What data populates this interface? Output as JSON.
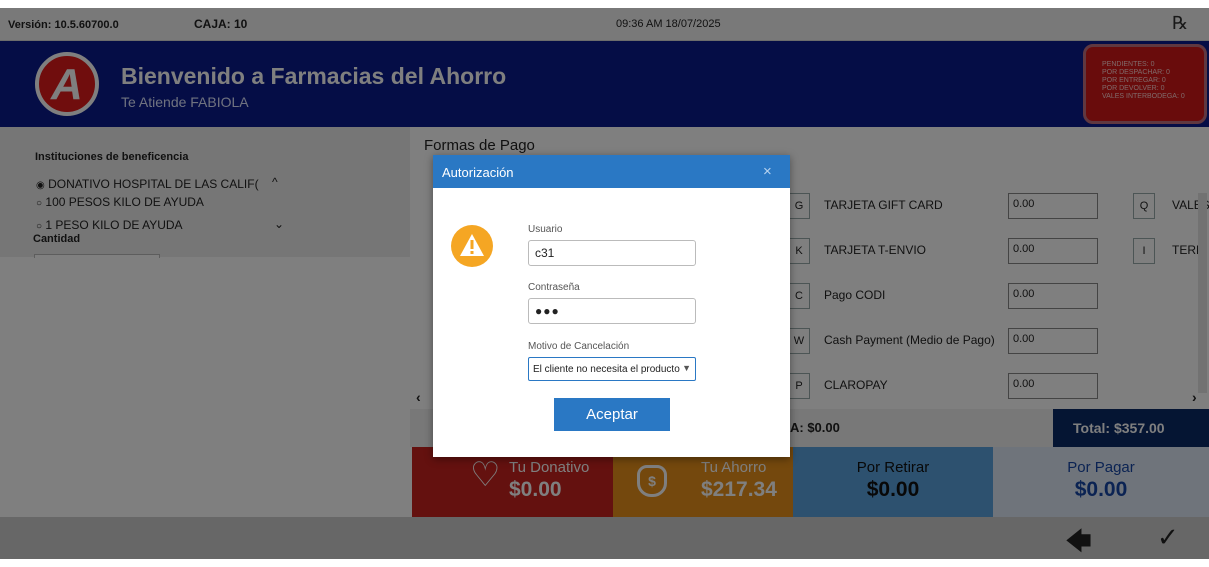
{
  "topbar": {
    "version": "Versión: 10.5.60700.0",
    "register": "CAJA: 10",
    "datetime": "09:36 AM 18/07/2025",
    "rx_icon": "prescription-icon"
  },
  "header": {
    "logo_letter": "A",
    "title": "Bienvenido a Farmacias del Ahorro",
    "subtitle": "Te Atiende FABIOLA",
    "status_lines": [
      "PENDIENTES: 0",
      "POR DESPACHAR: 0",
      "POR ENTREGAR: 0",
      "POR DEVOLVER: 0",
      "VALES INTERBODEGA: 0"
    ]
  },
  "charity": {
    "heading": "Instituciones de beneficencia",
    "options": [
      {
        "label": "DONATIVO HOSPITAL DE LAS CALIF(",
        "selected": true
      },
      {
        "label": "100 PESOS KILO DE AYUDA",
        "selected": false
      },
      {
        "label": "1 PESO KILO DE AYUDA",
        "selected": false
      }
    ],
    "quantity_label": "Cantidad",
    "quantity_value": ""
  },
  "payment": {
    "title": "Formas de Pago",
    "rows": [
      {
        "key": "G",
        "label": "TARJETA GIFT CARD",
        "value": "0.00",
        "key2": "Q",
        "label2": "VALES"
      },
      {
        "key": "K",
        "label": "TARJETA T-ENVIO",
        "value": "0.00",
        "key2": "I",
        "label2": "TERM"
      },
      {
        "key": "C",
        "label": "Pago CODI",
        "value": "0.00"
      },
      {
        "key": "W",
        "label": "Cash Payment (Medio de Pago)",
        "value": "0.00"
      },
      {
        "key": "P",
        "label": "CLAROPAY",
        "value": "0.00"
      }
    ],
    "iva_text": "A: $0.00",
    "total_text": "Total: $357.00"
  },
  "tiles": {
    "donation": {
      "label": "Tu Donativo",
      "value": "$0.00"
    },
    "savings": {
      "label": "Tu Ahorro",
      "value": "$217.34"
    },
    "withdraw": {
      "label": "Por Retirar",
      "value": "$0.00"
    },
    "pay": {
      "label": "Por Pagar",
      "value": "$0.00"
    }
  },
  "modal": {
    "title": "Autorización",
    "close": "×",
    "user_label": "Usuario",
    "user_value": "c31",
    "password_label": "Contraseña",
    "password_value": "●●●",
    "reason_label": "Motivo de Cancelación",
    "reason_value": "El cliente no necesita el producto",
    "accept": "Aceptar"
  },
  "colors": {
    "header_blue": "#0a1a8c",
    "modal_blue": "#2a78c4",
    "donation_red": "#c8231e",
    "savings_orange": "#e8901a",
    "withdraw_blue": "#5aa3df",
    "pay_light": "#dfe9f6",
    "total_navy": "#0a2a66"
  }
}
